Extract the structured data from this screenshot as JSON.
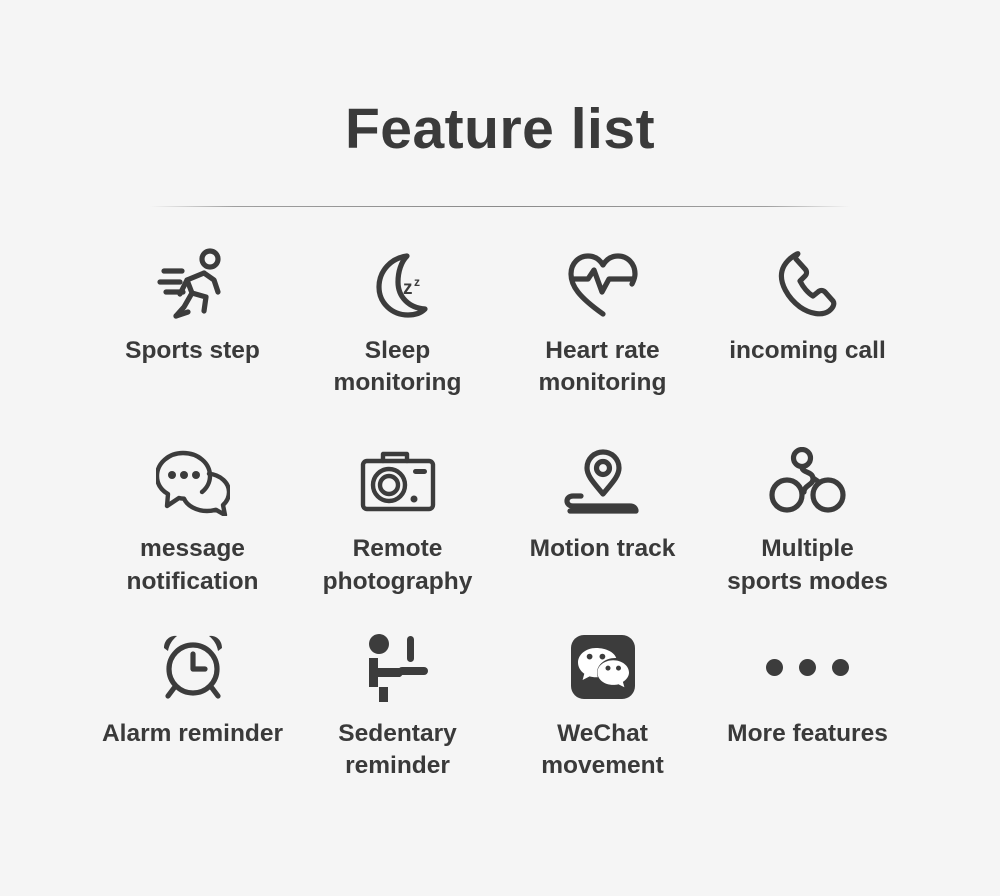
{
  "header": {
    "title": "Feature list"
  },
  "features": {
    "rows": [
      [
        {
          "label": "Sports step",
          "icon": "running-figure-icon"
        },
        {
          "label": "Sleep\nmonitoring",
          "icon": "crescent-moon-zzz-icon"
        },
        {
          "label": "Heart rate\nmonitoring",
          "icon": "heart-pulse-icon"
        },
        {
          "label": "incoming call",
          "icon": "phone-handset-icon"
        }
      ],
      [
        {
          "label": "message\nnotification",
          "icon": "speech-bubbles-icon"
        },
        {
          "label": "Remote\nphotography",
          "icon": "camera-icon"
        },
        {
          "label": "Motion track",
          "icon": "map-pin-path-icon"
        },
        {
          "label": "Multiple\nsports modes",
          "icon": "bicycle-icon"
        }
      ],
      [
        {
          "label": "Alarm reminder",
          "icon": "alarm-clock-icon"
        },
        {
          "label": "Sedentary\nreminder",
          "icon": "person-at-desk-icon"
        },
        {
          "label": "WeChat\nmovement",
          "icon": "wechat-logo-icon"
        },
        {
          "label": "More features",
          "icon": "ellipsis-dots-icon"
        }
      ]
    ]
  },
  "colors": {
    "background": "#f5f5f5",
    "ink": "#3c3c3c",
    "title": "#3a3a3a",
    "divider": "#8a8a8a"
  }
}
